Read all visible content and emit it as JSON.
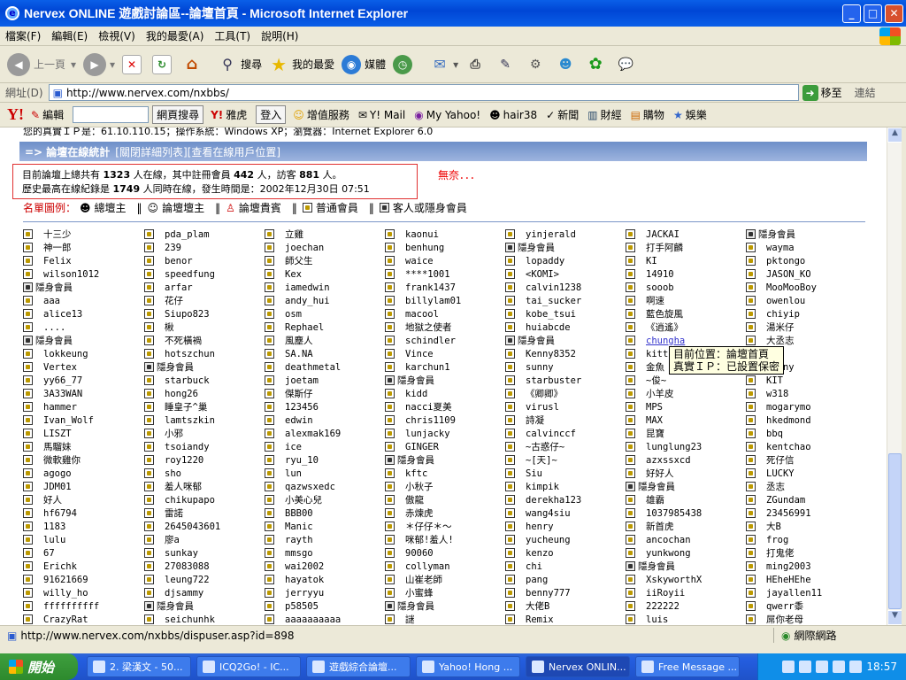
{
  "window": {
    "title": "Nervex ONLINE 遊戲討論區--論壇首頁 - Microsoft Internet Explorer",
    "min": "_",
    "max": "□",
    "close": "✕"
  },
  "menu": [
    "檔案(F)",
    "編輯(E)",
    "檢視(V)",
    "我的最愛(A)",
    "工具(T)",
    "說明(H)"
  ],
  "toolbar": {
    "back": "上一頁",
    "search": "搜尋",
    "favorites": "我的最愛",
    "media": "媒體"
  },
  "address": {
    "label": "網址(D)",
    "url": "http://www.nervex.com/nxbbs/",
    "go": "移至",
    "links": "連結"
  },
  "yahoo_bar": {
    "logo": "Y!",
    "edit": "編輯",
    "web_search": "網頁搜尋",
    "auction": "雅虎",
    "login": "登入",
    "value_service": "增值服務",
    "mail": "Y! Mail",
    "my_yahoo": "My Yahoo!",
    "user": "hair38",
    "news": "新聞",
    "finance": "財經",
    "shopping": "購物",
    "entertainment": "娛樂"
  },
  "page": {
    "top_line": "您的真實ＩＰ是：61.10.110.15；操作系統：Windows XP；瀏覽器：Internet Explorer 6.0",
    "stats_title": "=> 論壇在線統計",
    "stats_links": "[關閉詳細列表][查看在線用戶位置]",
    "online_line_pre": "目前論壇上總共有",
    "online_total": "1323",
    "online_line_mid1": "人在線，其中註冊會員",
    "online_members": "442",
    "online_line_mid2": "人，訪客",
    "online_guests": "881",
    "online_line_end": "人。",
    "record_pre": "歷史最高在線紀錄是",
    "record_count": "1749",
    "record_mid": "人同時在線，發生時間是：2002年12月30日 07:51",
    "wunai": "無奈．．．",
    "legend_label": "名單圖例：",
    "legend": [
      "總壇主",
      "論壇壇主",
      "論壇貴賓",
      "普通會員",
      "客人或隱身會員"
    ],
    "tooltip_1": "目前位置：論壇首頁",
    "tooltip_2": "真實ＩＰ：已設置保密"
  },
  "users": [
    [
      "十三少",
      "神一郎",
      "Felix",
      "wilson1012",
      "隱身會員",
      "aaa",
      "alice13",
      "....",
      "隱身會員",
      "lokkeung",
      "Vertex",
      "yy66_77",
      "3A33WAN",
      "hammer",
      "Ivan_Wolf",
      "LISZT",
      "馬騮妹",
      "微軟雞你",
      "agogo",
      "JDM01",
      "好人",
      "hf6794",
      "1183",
      "lulu",
      "67",
      "Erichk",
      "91621669",
      "willy_ho",
      "ffffffffff",
      "CrazyRat"
    ],
    [
      "pda_plam",
      "239",
      "benor",
      "speedfung",
      "arfar",
      "花仔",
      "Siupo823",
      "楸",
      "不死橫禍",
      "hotszchun",
      "隱身會員",
      "starbuck",
      "hong26",
      "睡皇子^巢",
      "lamtszkin",
      "小邪",
      "tsoiandy",
      "roy1220",
      "sho",
      "羞人咪郁",
      "chikupapo",
      "雷諾",
      "2645043601",
      "廖a",
      "sunkay",
      "27083088",
      "leung722",
      "djsammy",
      "隱身會員",
      "seichunhk"
    ],
    [
      "立雞",
      "joechan",
      "師父生",
      "Kex",
      "iamedwin",
      "andy_hui",
      "osm",
      "Rephael",
      "風塵人",
      "SA.NA",
      "deathmetal",
      "joetam",
      "傑斯仔",
      "123456",
      "edwin",
      "alexmak169",
      "ice",
      "ryu_10",
      "lun",
      "qazwsxedc",
      "小美心兒",
      "BBB00",
      "Manic",
      "rayth",
      "mmsgo",
      "wai2002",
      "hayatok",
      "jerryyu",
      "p58505",
      "aaaaaaaaaa"
    ],
    [
      "kaonui",
      "benhung",
      "waice",
      "****1001",
      "frank1437",
      "billylam01",
      "macool",
      "地獄之使者",
      "schindler",
      "Vince",
      "karchun1",
      "隱身會員",
      "kidd",
      "nacci夏美",
      "chris1109",
      "lunjacky",
      "GINGER",
      "隱身會員",
      "kftc",
      "小秋子",
      "傲龍",
      "赤煉虎",
      "＊仔仔＊～",
      "咪郁!羞人!",
      "90060",
      "collyman",
      "山崔老師",
      "小蜜蜂",
      "隱身會員",
      "謎"
    ],
    [
      "yinjerald",
      "隱身會員",
      "lopaddy",
      "<KOMI>",
      "calvin1238",
      "tai_sucker",
      "kobe_tsui",
      "huiabcde",
      "隱身會員",
      "Kenny8352",
      "sunny",
      "starbuster",
      "《卿卿》",
      "virusl",
      "詩凝",
      "calvinccf",
      "~古惑仔~",
      "~[天]~",
      "Siu",
      "kimpik",
      "derekha123",
      "wang4siu",
      "henry",
      "yucheung",
      "kenzo",
      "chi",
      "pang",
      "benny777",
      "大佬B",
      "Remix"
    ],
    [
      "JACKAI",
      "打手阿麟",
      "KI",
      "14910",
      "sooob",
      "啊速",
      "藍色旋風",
      "《逍遙》",
      "chungha",
      "kitt",
      "金魚",
      "~俊~",
      "小羊皮",
      "MPS",
      "MAX",
      "昆寶",
      "lunglung23",
      "azxssxcd",
      "好好人",
      "隱身會員",
      "雄霸",
      "1037985438",
      "新首虎",
      "ancochan",
      "yunkwong",
      "隱身會員",
      "XskyworthX",
      "iiRoyii",
      "222222",
      "luis"
    ],
    [
      "隱身會員",
      "wayma",
      "pktongo",
      "JASON_KO",
      "MooMooBoy",
      "owenlou",
      "chiyip",
      "湯米仔",
      "大丞志",
      "",
      "penny",
      "KIT",
      "w318",
      "mogarymo",
      "hkedmond",
      "bbq",
      "kentchao",
      "死仔信",
      "LUCKY",
      "丞志",
      "ZGundam",
      "23456991",
      "大B",
      "frog",
      "打鬼佬",
      "ming2003",
      "HEheHEhe",
      "jayallen11",
      "qwerr黍",
      "屌你老母"
    ]
  ],
  "status": {
    "url": "http://www.nervex.com/nxbbs/dispuser.asp?id=898",
    "zone": "網際網路"
  },
  "taskbar": {
    "start": "開始",
    "tasks": [
      "2. 梁漢文 - 50...",
      "ICQ2Go! - IC...",
      "遊戲綜合論壇...",
      "Yahoo! Hong ...",
      "Nervex ONLIN...",
      "Free Message ..."
    ],
    "clock": "18:57"
  }
}
